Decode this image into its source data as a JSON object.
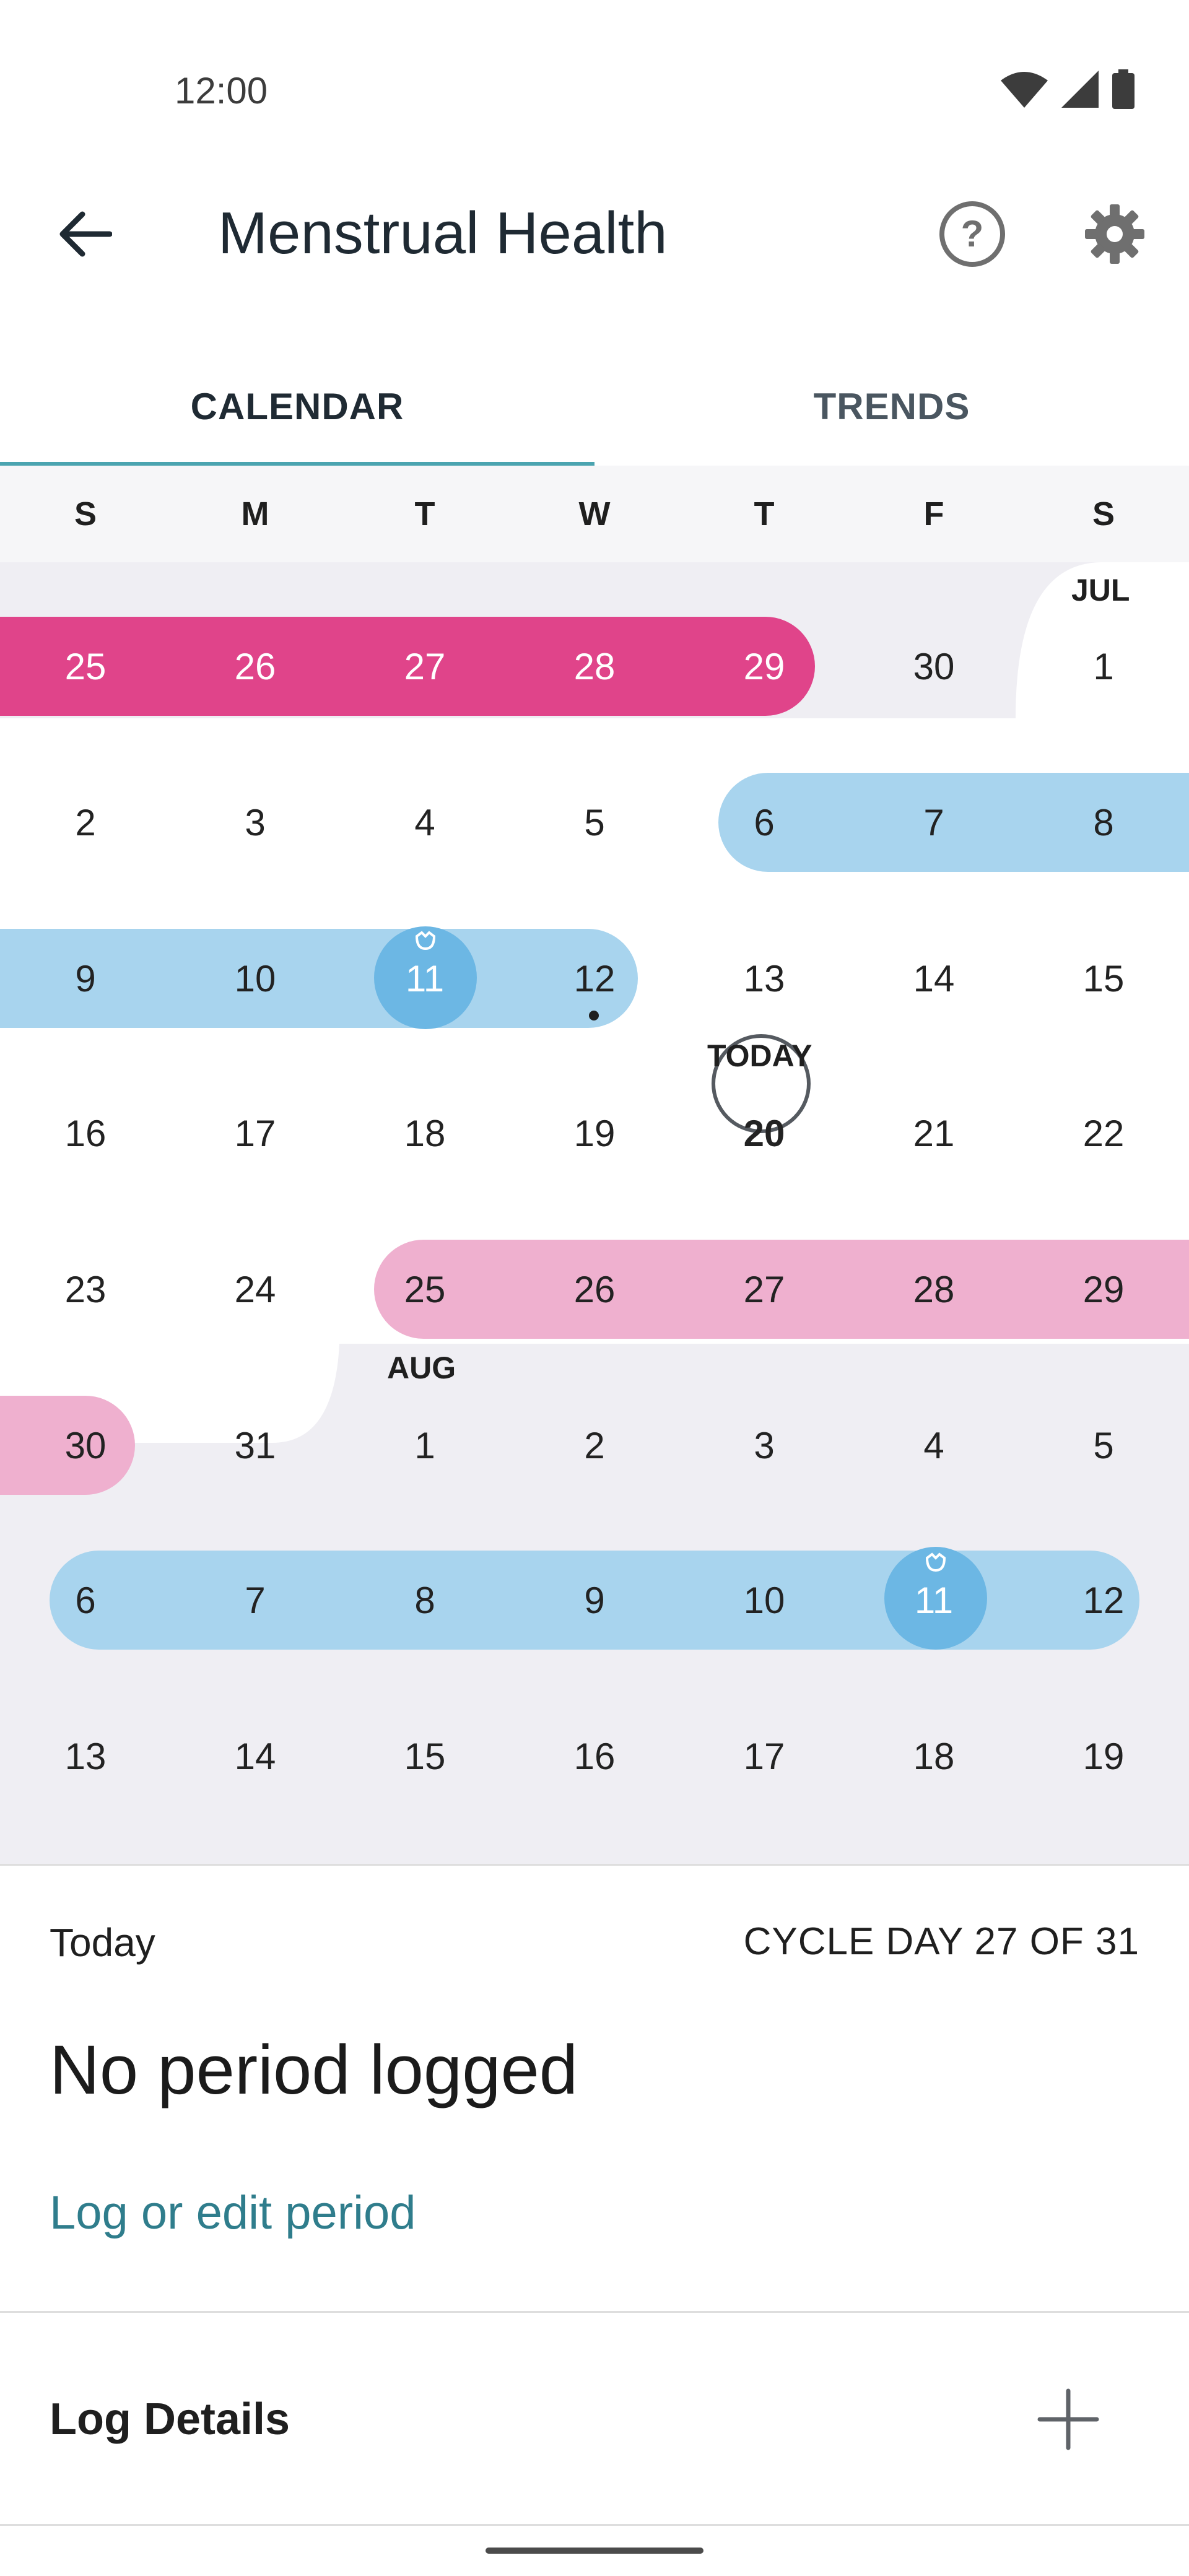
{
  "status_bar": {
    "time": "12:00",
    "icons": [
      "wifi-icon",
      "signal-icon",
      "battery-icon"
    ]
  },
  "app_bar": {
    "title": "Menstrual Health",
    "back_icon": "arrow-left-icon",
    "help_icon": "help-circle-icon",
    "settings_icon": "gear-icon"
  },
  "tabs": [
    {
      "label": "CALENDAR",
      "selected": true
    },
    {
      "label": "TRENDS",
      "selected": false
    }
  ],
  "weekdays": [
    "S",
    "M",
    "T",
    "W",
    "T",
    "F",
    "S"
  ],
  "calendar": {
    "month_labels": [
      "JUL",
      "AUG"
    ],
    "today_label": "TODAY",
    "weeks": [
      [
        "25",
        "26",
        "27",
        "28",
        "29",
        "30",
        "1"
      ],
      [
        "2",
        "3",
        "4",
        "5",
        "6",
        "7",
        "8"
      ],
      [
        "9",
        "10",
        "11",
        "12",
        "13",
        "14",
        "15"
      ],
      [
        "16",
        "17",
        "18",
        "19",
        "20",
        "21",
        "22"
      ],
      [
        "23",
        "24",
        "25",
        "26",
        "27",
        "28",
        "29"
      ],
      [
        "30",
        "31",
        "1",
        "2",
        "3",
        "4",
        "5"
      ],
      [
        "6",
        "7",
        "8",
        "9",
        "10",
        "11",
        "12"
      ],
      [
        "13",
        "14",
        "15",
        "16",
        "17",
        "18",
        "19"
      ]
    ],
    "colors": {
      "period": "#e0448a",
      "predicted_period": "#efb0cf",
      "fertile": "#a8d4ee",
      "ovulation": "#6cb7e4",
      "past_month_bg": "#efeef3"
    }
  },
  "summary": {
    "today": "Today",
    "cycle_day": "CYCLE DAY 27 OF 31",
    "status": "No period logged",
    "log_link": "Log or edit period"
  },
  "log_details": {
    "label": "Log Details",
    "add_icon": "plus-icon"
  }
}
